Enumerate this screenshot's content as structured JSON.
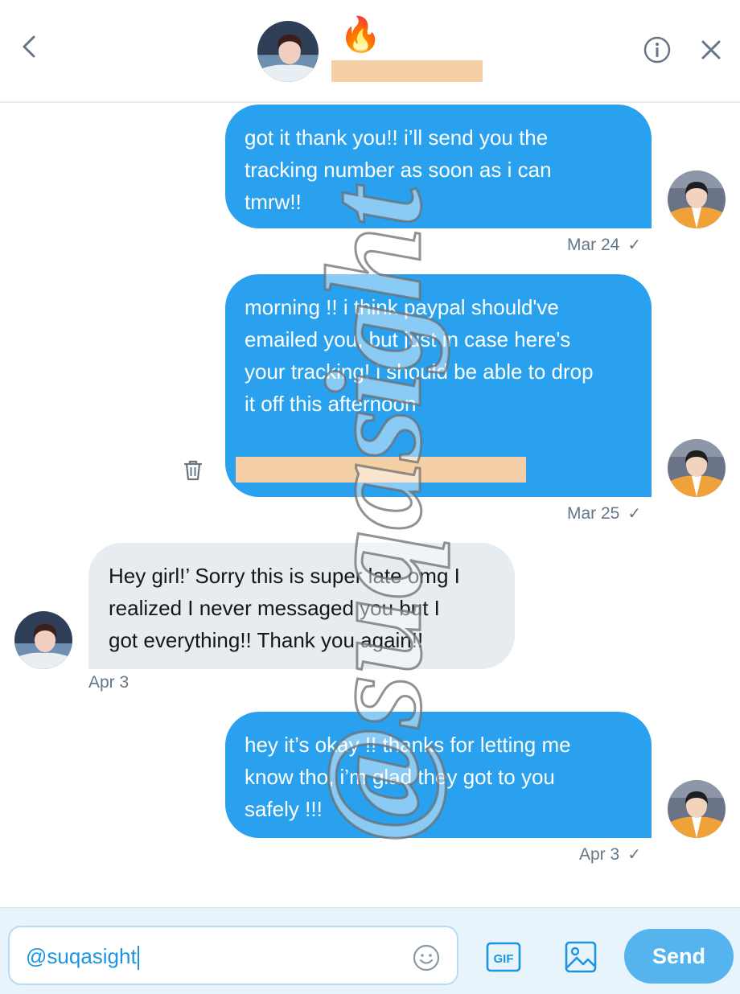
{
  "header": {
    "contact_emoji": "🔥",
    "back_icon": "chevron-left-icon",
    "info_icon": "info-icon",
    "close_icon": "close-icon"
  },
  "messages": [
    {
      "direction": "outgoing",
      "lines": [
        "got it thank you!! i’ll send you the",
        "tracking number as soon as i can",
        "tmrw!!"
      ],
      "timestamp": "Mar 24",
      "status": "✓"
    },
    {
      "direction": "outgoing",
      "lines": [
        "morning !! i think paypal should've",
        "emailed you, but just in case here's",
        "your tracking! i should be able to drop",
        "it off this afternoon"
      ],
      "timestamp": "Mar 25",
      "status": "✓",
      "has_redacted_link": true
    },
    {
      "direction": "incoming",
      "lines": [
        "Hey girl!’ Sorry this is super late omg I",
        "realized I never messaged you but I",
        "got everything!! Thank you again!!"
      ],
      "timestamp": "Apr 3"
    },
    {
      "direction": "outgoing",
      "lines": [
        "hey it’s okay !! thanks for letting me",
        "know tho, i’m glad they got to you",
        "safely !!!"
      ],
      "timestamp": "Apr 3",
      "status": "✓"
    }
  ],
  "watermark": "@suqasight",
  "composer": {
    "input_value": "@suqasight",
    "emoji_icon": "smiley-icon",
    "gif_label": "GIF",
    "image_icon": "image-icon",
    "send_label": "Send"
  },
  "colors": {
    "outgoing_bubble": "#2aa1ee",
    "incoming_bubble": "#e6ecf0",
    "accent": "#1b95e0",
    "send_button": "#55b4ee",
    "redaction": "#f5cfa6"
  }
}
